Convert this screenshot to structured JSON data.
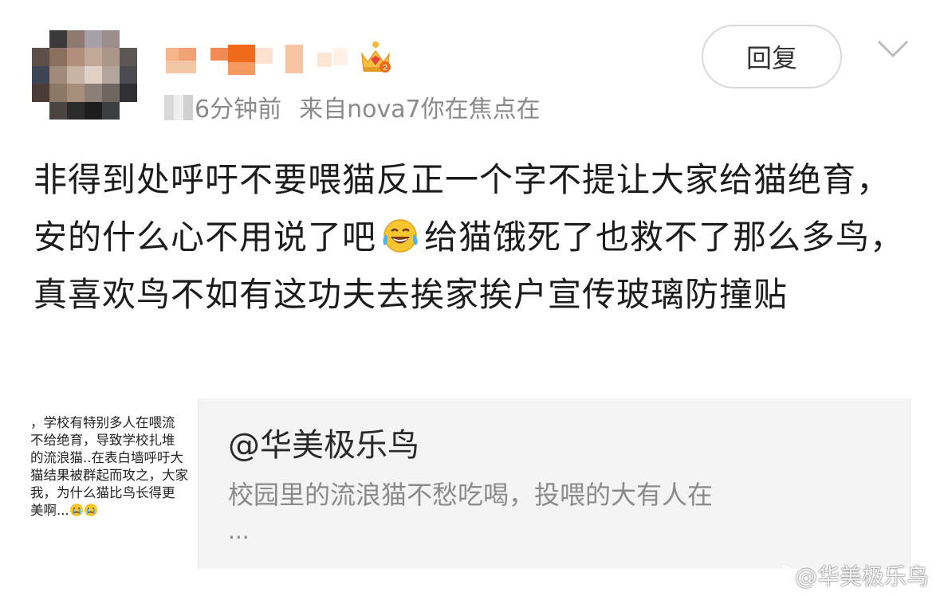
{
  "post": {
    "meta_time": "6分钟前",
    "meta_source": "来自nova7你在焦点在",
    "reply_label": "回复",
    "body_part1": "非得到处呼吁不要喂猫反正一个字不提让大家给猫绝育，安的什么心不用说了吧",
    "body_part2": "给猫饿死了也救不了那么多鸟，真喜欢鸟不如有这功夫去挨家挨户宣传玻璃防撞贴",
    "emoji": "laughing-crying-emoji"
  },
  "quote": {
    "thumb_lines": [
      "，学校有特别多人在喂流",
      "不给绝育，导致学校扎堆",
      "的流浪猫..在表白墙呼吁大",
      "猫结果被群起而攻之，大家",
      "我，为什么猫比鸟长得更",
      "美啊..."
    ],
    "author": "@华美极乐鸟",
    "text": "校园里的流浪猫不愁吃喝，投喂的大有人在",
    "ellipsis": "..."
  },
  "watermark": {
    "text": "@华美极乐鸟"
  },
  "colors": {
    "meta_gray": "#8a8a8a",
    "body_text": "#1c1c1c",
    "card_bg": "#f4f4f4",
    "accent_orange": "#f07a2a"
  },
  "icons": {
    "vip": "crown-vip-icon",
    "expand": "chevron-down-icon",
    "weibo": "weibo-logo-icon"
  }
}
